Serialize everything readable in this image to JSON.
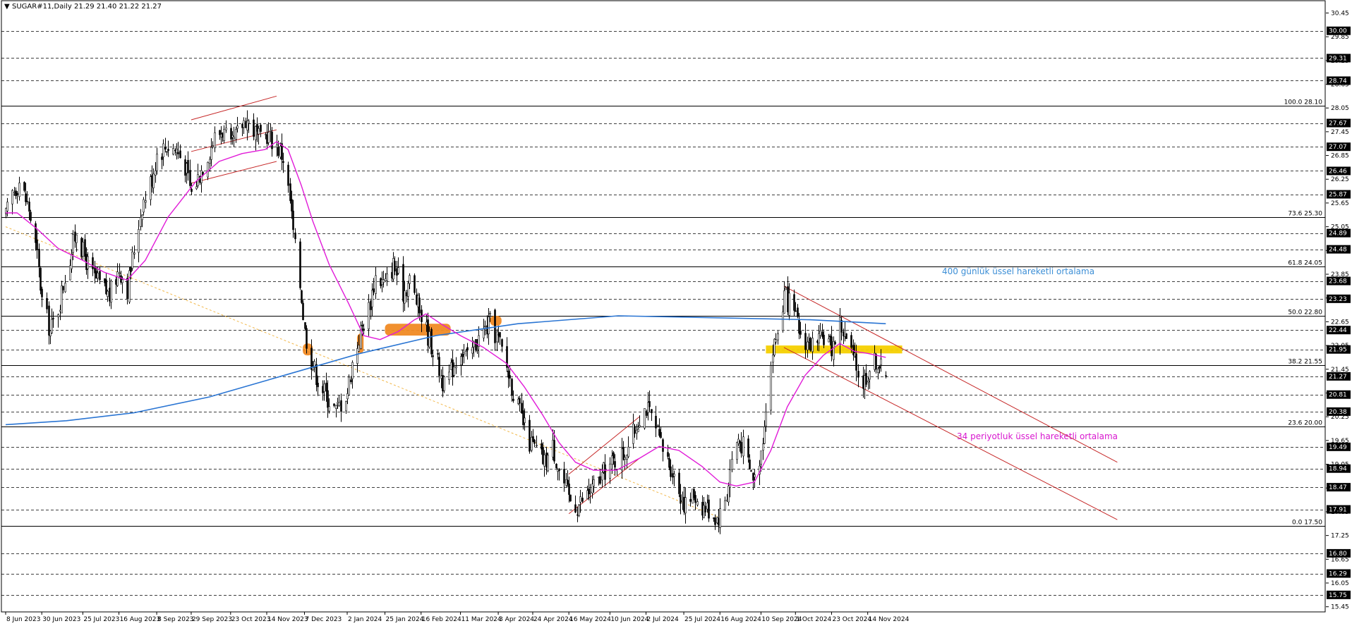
{
  "header": {
    "menu_glyph": "▼",
    "title": "SUGAR#11,Daily  21.29 21.40 21.22 21.27"
  },
  "colors": {
    "candle": "#000000",
    "ema34": "#e11ad8",
    "ema400": "#2a75d3",
    "channel": "#c62828",
    "trend_dotted": "#f2b84b",
    "highlight_orange": "#f08a24",
    "highlight_yellow": "#f5d000",
    "grid": "#000000",
    "tag_bg": "#000000",
    "tag_text": "#ffffff"
  },
  "annotations": {
    "ema400_label": "400 günlük üssel hareketli ortalama",
    "ema34_label": "34 periyotluk üssel hareketli ortalama"
  },
  "chart_data": {
    "type": "candlestick",
    "symbol": "SUGAR#11",
    "timeframe": "Daily",
    "last_bar": {
      "open": 21.29,
      "high": 21.4,
      "low": 21.22,
      "close": 21.27
    },
    "y_range": [
      15.5,
      30.45
    ],
    "y_ticks": [
      "30.45",
      "29.85",
      "29.25",
      "28.65",
      "28.05",
      "27.45",
      "26.85",
      "26.25",
      "25.65",
      "25.05",
      "24.45",
      "23.85",
      "23.25",
      "22.65",
      "22.05",
      "21.45",
      "20.85",
      "20.25",
      "19.65",
      "19.05",
      "18.45",
      "17.85",
      "17.25",
      "16.65",
      "16.05",
      "15.45"
    ],
    "price_tags": [
      "30.00",
      "29.31",
      "28.74",
      "27.67",
      "27.07",
      "26.46",
      "25.87",
      "24.89",
      "24.48",
      "23.68",
      "23.23",
      "22.44",
      "21.95",
      "21.27",
      "20.81",
      "20.38",
      "19.49",
      "18.94",
      "18.47",
      "17.91",
      "16.80",
      "16.29",
      "15.75"
    ],
    "fib_levels": [
      {
        "label": "100.0 28.10",
        "value": 28.1
      },
      {
        "label": "73.6 25.30",
        "value": 25.3
      },
      {
        "label": "61.8 24.05",
        "value": 24.05
      },
      {
        "label": "50.0 22.80",
        "value": 22.8
      },
      {
        "label": "38.2 21.55",
        "value": 21.55
      },
      {
        "label": "23.6 20.00",
        "value": 20.0
      },
      {
        "label": "0.0 17.50",
        "value": 17.5
      }
    ],
    "dates": [
      {
        "label": "8 Jun 2023",
        "day": 0
      },
      {
        "label": "30 Jun 2023",
        "day": 22
      },
      {
        "label": "25 Jul 2023",
        "day": 47
      },
      {
        "label": "16 Aug 2023",
        "day": 69
      },
      {
        "label": "8 Sep 2023",
        "day": 92
      },
      {
        "label": "29 Sep 2023",
        "day": 113
      },
      {
        "label": "23 Oct 2023",
        "day": 137
      },
      {
        "label": "14 Nov 2023",
        "day": 159
      },
      {
        "label": "7 Dec 2023",
        "day": 182
      },
      {
        "label": "2 Jan 2024",
        "day": 208
      },
      {
        "label": "25 Jan 2024",
        "day": 231
      },
      {
        "label": "16 Feb 2024",
        "day": 253
      },
      {
        "label": "11 Mar 2024",
        "day": 277
      },
      {
        "label": "3 Apr 2024",
        "day": 300
      },
      {
        "label": "24 Apr 2024",
        "day": 321
      },
      {
        "label": "16 May 2024",
        "day": 343
      },
      {
        "label": "10 Jun 2024",
        "day": 368
      },
      {
        "label": "2 Jul 2024",
        "day": 390
      },
      {
        "label": "25 Jul 2024",
        "day": 413
      },
      {
        "label": "16 Aug 2024",
        "day": 435
      },
      {
        "label": "10 Sep 2024",
        "day": 460
      },
      {
        "label": "1 Oct 2024",
        "day": 481
      },
      {
        "label": "23 Oct 2024",
        "day": 503
      },
      {
        "label": "14 Nov 2024",
        "day": 525
      }
    ],
    "date_range": [
      "2023-06-08",
      "2024-11-25"
    ],
    "close_path": [
      [
        "2023-06-08",
        25.3
      ],
      [
        "2023-06-12",
        25.9
      ],
      [
        "2023-06-16",
        26.2
      ],
      [
        "2023-06-22",
        25.5
      ],
      [
        "2023-06-27",
        24.3
      ],
      [
        "2023-06-30",
        23.2
      ],
      [
        "2023-07-05",
        22.4
      ],
      [
        "2023-07-10",
        23.0
      ],
      [
        "2023-07-14",
        23.8
      ],
      [
        "2023-07-19",
        24.6
      ],
      [
        "2023-07-21",
        25.0
      ],
      [
        "2023-07-25",
        24.4
      ],
      [
        "2023-07-31",
        23.8
      ],
      [
        "2023-08-04",
        23.6
      ],
      [
        "2023-08-10",
        23.3
      ],
      [
        "2023-08-16",
        24.0
      ],
      [
        "2023-08-21",
        23.5
      ],
      [
        "2023-08-25",
        24.5
      ],
      [
        "2023-08-30",
        25.6
      ],
      [
        "2023-09-05",
        26.3
      ],
      [
        "2023-09-08",
        26.9
      ],
      [
        "2023-09-14",
        27.1
      ],
      [
        "2023-09-20",
        27.0
      ],
      [
        "2023-09-25",
        26.6
      ],
      [
        "2023-09-29",
        25.9
      ],
      [
        "2023-10-04",
        26.4
      ],
      [
        "2023-10-09",
        26.9
      ],
      [
        "2023-10-13",
        27.3
      ],
      [
        "2023-10-18",
        27.5
      ],
      [
        "2023-10-23",
        27.0
      ],
      [
        "2023-10-27",
        27.4
      ],
      [
        "2023-11-01",
        27.8
      ],
      [
        "2023-11-06",
        27.5
      ],
      [
        "2023-11-10",
        27.2
      ],
      [
        "2023-11-14",
        27.4
      ],
      [
        "2023-11-20",
        27.1
      ],
      [
        "2023-11-24",
        26.8
      ],
      [
        "2023-11-28",
        25.7
      ],
      [
        "2023-12-01",
        24.5
      ],
      [
        "2023-12-05",
        23.3
      ],
      [
        "2023-12-07",
        22.4
      ],
      [
        "2023-12-11",
        21.7
      ],
      [
        "2023-12-15",
        21.2
      ],
      [
        "2023-12-20",
        20.8
      ],
      [
        "2023-12-26",
        20.4
      ],
      [
        "2024-01-02",
        20.9
      ],
      [
        "2024-01-05",
        21.6
      ],
      [
        "2024-01-10",
        22.4
      ],
      [
        "2024-01-15",
        23.0
      ],
      [
        "2024-01-19",
        23.8
      ],
      [
        "2024-01-25",
        23.6
      ],
      [
        "2024-01-30",
        24.1
      ],
      [
        "2024-02-05",
        23.4
      ],
      [
        "2024-02-09",
        23.7
      ],
      [
        "2024-02-16",
        22.8
      ],
      [
        "2024-02-21",
        22.2
      ],
      [
        "2024-02-26",
        21.6
      ],
      [
        "2024-03-01",
        21.0
      ],
      [
        "2024-03-06",
        21.5
      ],
      [
        "2024-03-11",
        22.0
      ],
      [
        "2024-03-15",
        21.7
      ],
      [
        "2024-03-20",
        22.1
      ],
      [
        "2024-03-25",
        22.4
      ],
      [
        "2024-03-29",
        22.6
      ],
      [
        "2024-04-03",
        22.2
      ],
      [
        "2024-04-08",
        21.5
      ],
      [
        "2024-04-12",
        20.9
      ],
      [
        "2024-04-17",
        20.2
      ],
      [
        "2024-04-22",
        19.6
      ],
      [
        "2024-04-26",
        19.4
      ],
      [
        "2024-05-01",
        19.1
      ],
      [
        "2024-05-06",
        19.5
      ],
      [
        "2024-05-10",
        18.9
      ],
      [
        "2024-05-16",
        18.2
      ],
      [
        "2024-05-21",
        18.0
      ],
      [
        "2024-05-27",
        18.3
      ],
      [
        "2024-06-03",
        18.6
      ],
      [
        "2024-06-07",
        18.9
      ],
      [
        "2024-06-12",
        19.1
      ],
      [
        "2024-06-18",
        19.3
      ],
      [
        "2024-06-24",
        19.8
      ],
      [
        "2024-06-28",
        20.3
      ],
      [
        "2024-07-02",
        20.5
      ],
      [
        "2024-07-08",
        19.9
      ],
      [
        "2024-07-12",
        19.4
      ],
      [
        "2024-07-17",
        19.0
      ],
      [
        "2024-07-22",
        18.4
      ],
      [
        "2024-07-26",
        18.0
      ],
      [
        "2024-07-31",
        18.3
      ],
      [
        "2024-08-05",
        18.0
      ],
      [
        "2024-08-09",
        17.9
      ],
      [
        "2024-08-14",
        17.7
      ],
      [
        "2024-08-16",
        17.8
      ],
      [
        "2024-08-20",
        18.3
      ],
      [
        "2024-08-23",
        19.2
      ],
      [
        "2024-08-27",
        19.7
      ],
      [
        "2024-08-30",
        19.5
      ],
      [
        "2024-09-03",
        18.9
      ],
      [
        "2024-09-06",
        18.7
      ],
      [
        "2024-09-10",
        19.4
      ],
      [
        "2024-09-13",
        20.6
      ],
      [
        "2024-09-17",
        21.9
      ],
      [
        "2024-09-20",
        22.4
      ],
      [
        "2024-09-24",
        23.3
      ],
      [
        "2024-09-27",
        23.1
      ],
      [
        "2024-10-01",
        22.7
      ],
      [
        "2024-10-04",
        22.3
      ],
      [
        "2024-10-09",
        22.1
      ],
      [
        "2024-10-14",
        22.0
      ],
      [
        "2024-10-18",
        22.3
      ],
      [
        "2024-10-23",
        22.0
      ],
      [
        "2024-10-28",
        22.6
      ],
      [
        "2024-11-01",
        22.2
      ],
      [
        "2024-11-06",
        21.6
      ],
      [
        "2024-11-11",
        21.1
      ],
      [
        "2024-11-14",
        21.4
      ],
      [
        "2024-11-19",
        21.7
      ],
      [
        "2024-11-22",
        21.5
      ],
      [
        "2024-11-25",
        21.27
      ]
    ],
    "ema34": [
      [
        "2023-06-08",
        25.4
      ],
      [
        "2023-06-15",
        25.4
      ],
      [
        "2023-06-27",
        25.0
      ],
      [
        "2023-07-10",
        24.5
      ],
      [
        "2023-07-25",
        24.2
      ],
      [
        "2023-08-07",
        23.9
      ],
      [
        "2023-08-21",
        23.7
      ],
      [
        "2023-09-01",
        24.2
      ],
      [
        "2023-09-15",
        25.3
      ],
      [
        "2023-10-02",
        26.2
      ],
      [
        "2023-10-16",
        26.7
      ],
      [
        "2023-10-30",
        26.9
      ],
      [
        "2023-11-13",
        27.0
      ],
      [
        "2023-11-20",
        27.2
      ],
      [
        "2023-11-27",
        27.0
      ],
      [
        "2023-12-05",
        26.1
      ],
      [
        "2023-12-12",
        25.2
      ],
      [
        "2023-12-22",
        24.1
      ],
      [
        "2024-01-03",
        23.1
      ],
      [
        "2024-01-12",
        22.3
      ],
      [
        "2024-01-22",
        22.2
      ],
      [
        "2024-02-02",
        22.4
      ],
      [
        "2024-02-12",
        22.7
      ],
      [
        "2024-02-19",
        22.85
      ],
      [
        "2024-02-28",
        22.6
      ],
      [
        "2024-03-11",
        22.3
      ],
      [
        "2024-03-25",
        22.0
      ],
      [
        "2024-04-08",
        21.6
      ],
      [
        "2024-04-19",
        21.0
      ],
      [
        "2024-04-30",
        20.3
      ],
      [
        "2024-05-10",
        19.6
      ],
      [
        "2024-05-20",
        19.1
      ],
      [
        "2024-05-31",
        18.9
      ],
      [
        "2024-06-14",
        18.9
      ],
      [
        "2024-06-28",
        19.2
      ],
      [
        "2024-07-10",
        19.5
      ],
      [
        "2024-07-22",
        19.4
      ],
      [
        "2024-08-05",
        19.0
      ],
      [
        "2024-08-16",
        18.6
      ],
      [
        "2024-08-26",
        18.5
      ],
      [
        "2024-09-06",
        18.6
      ],
      [
        "2024-09-16",
        19.4
      ],
      [
        "2024-09-26",
        20.5
      ],
      [
        "2024-10-07",
        21.3
      ],
      [
        "2024-10-18",
        21.8
      ],
      [
        "2024-10-28",
        22.1
      ],
      [
        "2024-11-06",
        21.9
      ],
      [
        "2024-11-14",
        21.85
      ],
      [
        "2024-11-25",
        21.75
      ]
    ],
    "ema400": [
      [
        "2023-06-08",
        20.05
      ],
      [
        "2023-07-15",
        20.15
      ],
      [
        "2023-08-25",
        20.35
      ],
      [
        "2023-10-10",
        20.75
      ],
      [
        "2023-11-25",
        21.3
      ],
      [
        "2024-01-10",
        21.85
      ],
      [
        "2024-02-25",
        22.3
      ],
      [
        "2024-04-15",
        22.6
      ],
      [
        "2024-06-15",
        22.8
      ],
      [
        "2024-08-15",
        22.75
      ],
      [
        "2024-10-10",
        22.7
      ],
      [
        "2024-11-25",
        22.6
      ]
    ],
    "channels": [
      {
        "kind": "upper",
        "p1": [
          "2024-09-24",
          23.55
        ],
        "p2": [
          "2025-04-15",
          19.1
        ]
      },
      {
        "kind": "lower",
        "p1": [
          "2024-09-24",
          22.0
        ],
        "p2": [
          "2025-04-15",
          17.65
        ]
      },
      {
        "kind": "upper",
        "p1": [
          "2024-05-16",
          18.8
        ],
        "p2": [
          "2024-06-28",
          20.25
        ]
      },
      {
        "kind": "lower",
        "p1": [
          "2024-05-16",
          17.8
        ],
        "p2": [
          "2024-06-28",
          19.2
        ]
      },
      {
        "kind": "upper",
        "p1": [
          "2023-09-29",
          27.75
        ],
        "p2": [
          "2023-11-20",
          28.35
        ]
      },
      {
        "kind": "lower",
        "p1": [
          "2023-09-29",
          26.15
        ],
        "p2": [
          "2023-11-20",
          26.7
        ]
      },
      {
        "kind": "mid",
        "p1": [
          "2023-09-29",
          26.95
        ],
        "p2": [
          "2023-11-20",
          27.5
        ]
      }
    ],
    "trend_dotted": [
      [
        "2023-06-08",
        25.05
      ],
      [
        "2024-08-16",
        17.7
      ]
    ],
    "highlight_zones": [
      {
        "color": "orange",
        "from": "2023-12-06",
        "to": "2023-12-12",
        "low": 21.8,
        "high": 22.1
      },
      {
        "color": "orange",
        "from": "2024-01-08",
        "to": "2024-01-12",
        "low": 21.85,
        "high": 22.35
      },
      {
        "color": "orange",
        "from": "2024-01-25",
        "to": "2024-03-05",
        "low": 22.3,
        "high": 22.6
      },
      {
        "color": "orange",
        "from": "2024-03-29",
        "to": "2024-04-05",
        "low": 22.55,
        "high": 22.8
      },
      {
        "color": "yellow",
        "from": "2024-09-13",
        "to": "2024-12-05",
        "low": 21.85,
        "high": 22.05
      }
    ]
  }
}
